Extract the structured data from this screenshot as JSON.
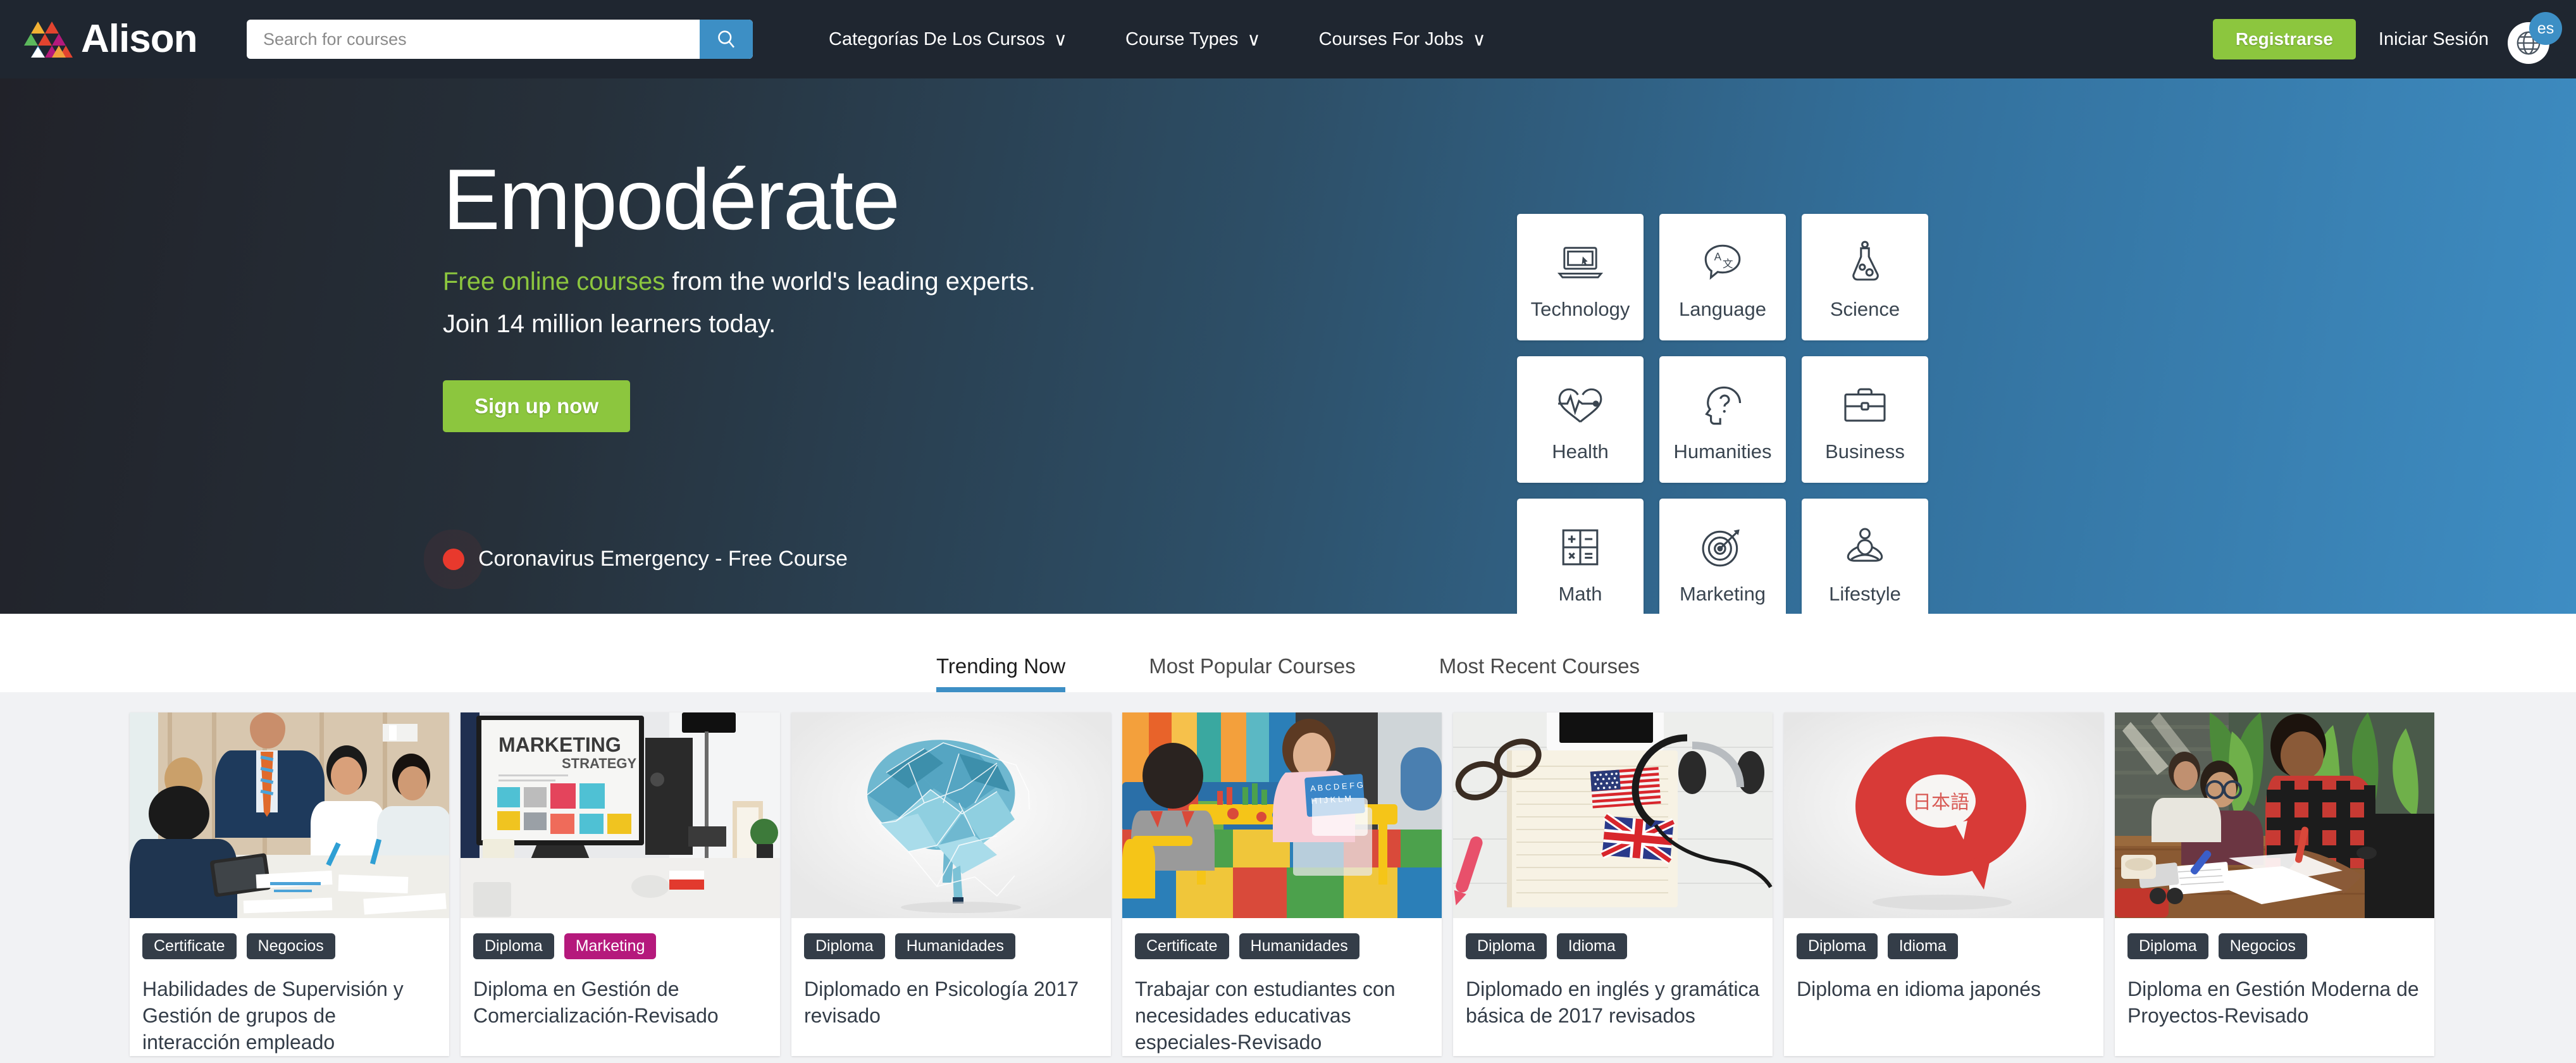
{
  "header": {
    "logo_text": "Alison",
    "logo_icon": "alison-triangle-logo",
    "search": {
      "placeholder": "Search for courses",
      "value": "",
      "button_icon": "search-icon"
    },
    "nav": [
      {
        "label": "Categorías De Los Cursos",
        "caret": "∨"
      },
      {
        "label": "Course Types",
        "caret": "∨"
      },
      {
        "label": "Courses For Jobs",
        "caret": "∨"
      }
    ],
    "register_label": "Registrarse",
    "login_label": "Iniciar Sesión",
    "language_code": "es",
    "language_icon": "globe-icon",
    "bg_color": "#1f2630",
    "accent_green": "#8cc63e",
    "accent_blue": "#3d8fc5"
  },
  "hero": {
    "title": "Empodérate",
    "subtitle_highlight": "Free online courses",
    "subtitle_rest": " from the world's leading experts.",
    "subtitle_line2": "Join 14 million learners today.",
    "cta_label": "Sign up now",
    "notice_text": "Coronavirus Emergency - Free Course",
    "notice_dot_color": "#e8392d",
    "gradient_from": "#212229",
    "gradient_to": "#3e8dc3",
    "categories": [
      {
        "label": "Technology",
        "icon": "laptop-icon"
      },
      {
        "label": "Language",
        "icon": "speech-bubble-translate-icon"
      },
      {
        "label": "Science",
        "icon": "flask-icon"
      },
      {
        "label": "Health",
        "icon": "heart-pulse-icon"
      },
      {
        "label": "Humanities",
        "icon": "head-question-icon"
      },
      {
        "label": "Business",
        "icon": "briefcase-icon"
      },
      {
        "label": "Math",
        "icon": "calculator-icon"
      },
      {
        "label": "Marketing",
        "icon": "target-arrow-icon"
      },
      {
        "label": "Lifestyle",
        "icon": "meditation-icon"
      }
    ]
  },
  "tabs": [
    {
      "label": "Trending Now",
      "active": true
    },
    {
      "label": "Most Popular Courses",
      "active": false
    },
    {
      "label": "Most Recent Courses",
      "active": false
    }
  ],
  "courses": [
    {
      "tags": [
        "Certificate",
        "Negocios"
      ],
      "tag_colors": [
        "#343d48",
        "#343d48"
      ],
      "title": "Habilidades de Supervisión y Gestión de grupos de interacción empleado",
      "image": "business-meeting-photo"
    },
    {
      "tags": [
        "Diploma",
        "Marketing"
      ],
      "tag_colors": [
        "#343d48",
        "#b5197c"
      ],
      "title": "Diploma en Gestión de Comercialización-Revisado",
      "image": "marketing-strategy-monitor-photo"
    },
    {
      "tags": [
        "Diploma",
        "Humanidades"
      ],
      "tag_colors": [
        "#343d48",
        "#343d48"
      ],
      "title": "Diplomado en Psicología 2017 revisado",
      "image": "polygonal-brain-illustration"
    },
    {
      "tags": [
        "Certificate",
        "Humanidades"
      ],
      "tag_colors": [
        "#343d48",
        "#343d48"
      ],
      "title": "Trabajar con estudiantes con necesidades educativas especiales-Revisado",
      "image": "child-teacher-classroom-photo"
    },
    {
      "tags": [
        "Diploma",
        "Idioma"
      ],
      "tag_colors": [
        "#343d48",
        "#343d48"
      ],
      "title": "Diplomado en inglés y gramática básica de 2017 revisados",
      "image": "flags-notebook-headphones-photo"
    },
    {
      "tags": [
        "Diploma",
        "Idioma"
      ],
      "tag_colors": [
        "#343d48",
        "#343d48"
      ],
      "title": "Diploma en idioma japonés",
      "image": "japanese-speech-bubble-illustration"
    },
    {
      "tags": [
        "Diploma",
        "Negocios"
      ],
      "tag_colors": [
        "#343d48",
        "#343d48"
      ],
      "title": "Diploma en Gestión Moderna de Proyectos-Revisado",
      "image": "students-studying-photo"
    }
  ]
}
